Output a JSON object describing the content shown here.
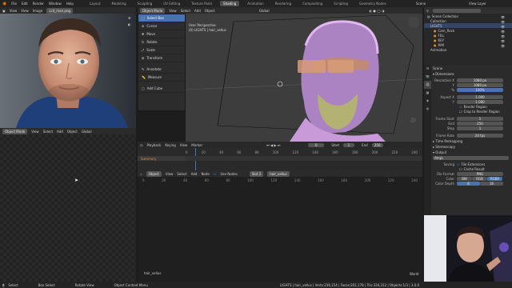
{
  "menu": [
    "File",
    "Edit",
    "Render",
    "Window",
    "Help"
  ],
  "workspaces": [
    "Layout",
    "Modeling",
    "Sculpting",
    "UV Editing",
    "Texture Paint",
    "Shading",
    "Animation",
    "Rendering",
    "Compositing",
    "Scripting",
    "Geometry Nodes"
  ],
  "active_workspace": "Shading",
  "scene_label": "Scene",
  "view_layer_label": "View Layer",
  "image_editor": {
    "header": [
      "View",
      "View",
      "Image"
    ],
    "image_name": "cc4_man.png",
    "footer_mode": "Object Mode",
    "footer_menu": [
      "View",
      "Select",
      "Add",
      "Object"
    ],
    "footer_view": "Global"
  },
  "viewport": {
    "header_mode": "Object Mode",
    "header_menu": [
      "View",
      "Select",
      "Add",
      "Object"
    ],
    "orientation": "Global",
    "info_line1": "User Perspective",
    "info_line2": "(0) LIGHTS | hair_vellus",
    "tools": [
      "Select Box",
      "Cursor",
      "Move",
      "Rotate",
      "Scale",
      "Transform",
      "Annotate",
      "Measure",
      "Add Cube"
    ],
    "active_tool": "Select Box"
  },
  "timeline": {
    "menu": [
      "Playback",
      "Keying",
      "View",
      "Marker"
    ],
    "current_frame": "0",
    "start_label": "Start",
    "start": "1",
    "end_label": "End",
    "end": "250",
    "ticks": [
      "0",
      "20",
      "40",
      "60",
      "80",
      "100",
      "120",
      "140",
      "160",
      "180",
      "200",
      "220",
      "240"
    ],
    "summary": "Summary"
  },
  "node_editor": {
    "header_type": "Object",
    "header_menu": [
      "View",
      "Select",
      "Add",
      "Node"
    ],
    "use_nodes": "Use Nodes",
    "slot": "Slot 2",
    "material": "hair_vellus",
    "ticks": [
      "0",
      "20",
      "40",
      "60",
      "80",
      "100",
      "120",
      "140",
      "160",
      "180",
      "200",
      "220",
      "240"
    ],
    "bottom_label": "hair_vellus",
    "corner_label": "World"
  },
  "outliner": {
    "title": "Scene Collection",
    "rows": [
      "Collection",
      "LIGHTS",
      "Cam_Rock",
      "FILL",
      "KEY",
      "RIM",
      "Animation"
    ]
  },
  "properties": {
    "scene": "Scene",
    "dimensions_header": "Dimensions",
    "resolution_x_label": "Resolution X",
    "resolution_x": "1080 px",
    "y_label": "Y",
    "resolution_y": "1080 px",
    "percent_label": "%",
    "percent": "100%",
    "aspect_x_label": "Aspect X",
    "aspect_x": "1.000",
    "aspect_y": "1.000",
    "render_region": "Render Region",
    "crop_region": "Crop to Render Region",
    "frame_start_label": "Frame Start",
    "frame_start": "1",
    "end_label": "End",
    "frame_end": "250",
    "step_label": "Step",
    "step": "1",
    "frame_rate_label": "Frame Rate",
    "frame_rate": "24 fps",
    "time_remap": "Time Remapping",
    "stereoscopy": "Stereoscopy",
    "output_header": "Output",
    "output_path": "/tmp\\",
    "saving_label": "Saving",
    "file_ext": "File Extensions",
    "cache_result": "Cache Result",
    "file_format_label": "File Format",
    "file_format": "PNG",
    "color_label": "Color",
    "color_opts": [
      "BW",
      "RGB",
      "RGBA"
    ],
    "color_depth_label": "Color Depth",
    "color_depth_opts": [
      "8",
      "16"
    ]
  },
  "statusbar": {
    "left": [
      "Select",
      "Box Select",
      "Rotate View",
      "Object Context Menu"
    ],
    "right": "LIGHTS | hair_vellus | Verts:236,154 | Faces:201,178 | Tris:334,312 | Objects:1/3 | 3.0.0"
  },
  "colors": {
    "accent": "#4772b3",
    "active_tab": "#4f4f4f",
    "keyframe_orange": "#e58a2e",
    "playhead": "#4772b3"
  }
}
